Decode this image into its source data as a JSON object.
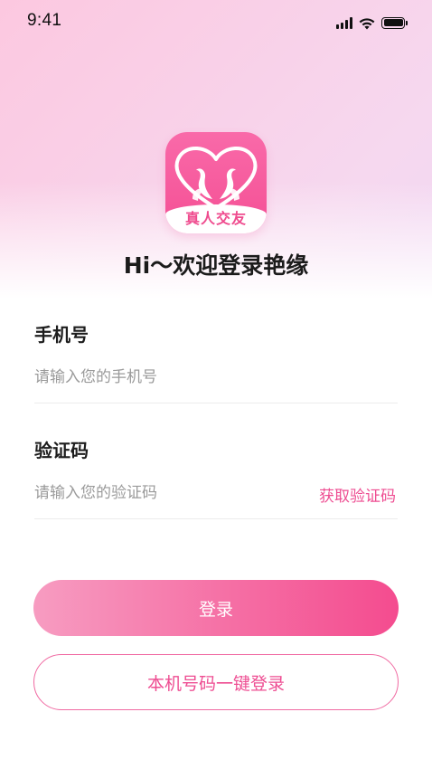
{
  "status_bar": {
    "time": "9:41"
  },
  "logo": {
    "text": "真人交友"
  },
  "welcome": "Hi～欢迎登录艳缘",
  "phone": {
    "label": "手机号",
    "placeholder": "请输入您的手机号",
    "value": ""
  },
  "code": {
    "label": "验证码",
    "placeholder": "请输入您的验证码",
    "value": "",
    "get_code_label": "获取验证码"
  },
  "buttons": {
    "login": "登录",
    "one_key_login": "本机号码一键登录"
  },
  "colors": {
    "accent": "#ee4d92",
    "logo_pink": "#f65a9c",
    "background_tint": "#f6d8ef"
  },
  "icons": [
    "signal-icon",
    "wifi-icon",
    "battery-icon",
    "swan-logo-icon"
  ]
}
